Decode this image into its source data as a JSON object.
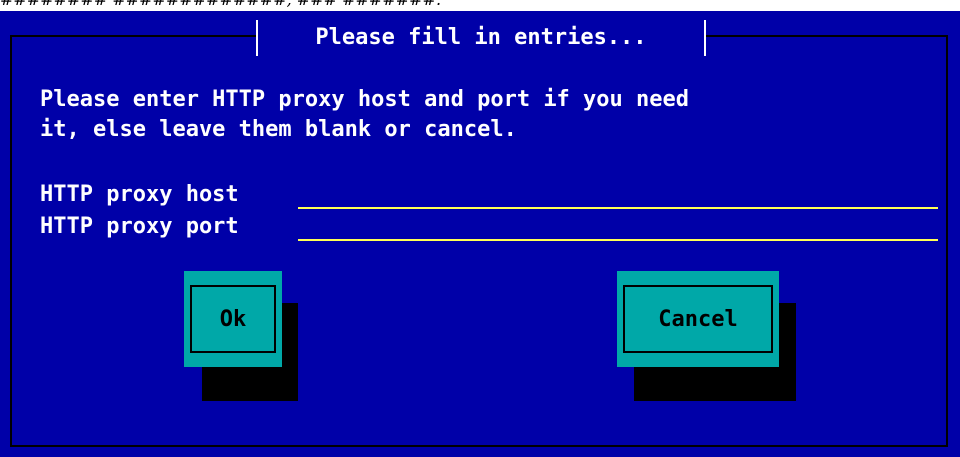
{
  "top_banner_text": "######## #############, ### #######.",
  "dialog": {
    "title": "Please fill in entries...",
    "message": "Please enter HTTP proxy host and port if you need\nit, else leave them blank or cancel.",
    "fields": [
      {
        "label": "HTTP proxy host",
        "value": "",
        "placeholder": ""
      },
      {
        "label": "HTTP proxy port",
        "value": "",
        "placeholder": ""
      }
    ],
    "buttons": {
      "ok_label": "Ok",
      "cancel_label": "Cancel"
    }
  },
  "colors": {
    "dialog_background": "#0000a8",
    "text": "#ffffff",
    "input_underline": "#ffff55",
    "button_background": "#00a8a8",
    "button_shadow": "#000000"
  }
}
